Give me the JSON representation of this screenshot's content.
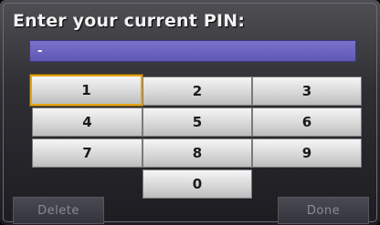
{
  "prompt": "Enter your current PIN:",
  "pin_field": {
    "value": "-"
  },
  "keypad": {
    "k1": "1",
    "k2": "2",
    "k3": "3",
    "k4": "4",
    "k5": "5",
    "k6": "6",
    "k7": "7",
    "k8": "8",
    "k9": "9",
    "k0": "0",
    "selected": "1"
  },
  "softkeys": {
    "delete": "Delete",
    "done": "Done"
  },
  "colors": {
    "field": "#6b63c2",
    "selection": "#e6a315",
    "key_face": "#dcdcdc"
  }
}
